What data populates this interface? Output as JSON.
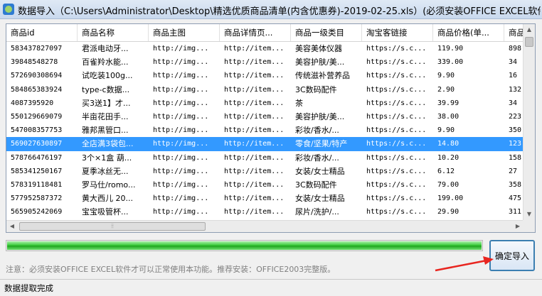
{
  "window": {
    "title": "数据导入（C:\\Users\\Administrator\\Desktop\\精选优质商品清单(内含优惠券)-2019-02-25.xls）(必须安装OFFICE EXCEL软件"
  },
  "table": {
    "columns": [
      "商品id",
      "商品名称",
      "商品主图",
      "商品详情页...",
      "商品一级类目",
      "淘宝客链接",
      "商品价格(单...",
      "商品"
    ],
    "rows": [
      [
        "583437827097",
        "君派电动牙...",
        "http://img...",
        "http://item...",
        "美容美体仪器",
        "https://s.c...",
        "119.90",
        "898"
      ],
      [
        "39848548278",
        "百雀羚水能...",
        "http://img...",
        "http://item...",
        "美容护肤/美...",
        "https://s.c...",
        "339.00",
        "34"
      ],
      [
        "572690308694",
        "试吃装100g...",
        "http://img...",
        "http://item...",
        "传统滋补营养品",
        "https://s.c...",
        "9.90",
        "16"
      ],
      [
        "584865383924",
        "type-c数据...",
        "http://img...",
        "http://item...",
        "3C数码配件",
        "https://s.c...",
        "2.90",
        "132"
      ],
      [
        "4087395920",
        "买3送1】才...",
        "http://img...",
        "http://item...",
        "茶",
        "https://s.c...",
        "39.99",
        "34"
      ],
      [
        "550129669079",
        "半亩花田手...",
        "http://img...",
        "http://item...",
        "美容护肤/美...",
        "https://s.c...",
        "38.00",
        "223"
      ],
      [
        "547008357753",
        "雅邦黑管口...",
        "http://img...",
        "http://item...",
        "彩妆/香水/...",
        "https://s.c...",
        "9.90",
        "350"
      ],
      [
        "569027630897",
        "全店满3袋包...",
        "http://img...",
        "http://item...",
        "零食/坚果/特产",
        "https://s.c...",
        "14.80",
        "123"
      ],
      [
        "578766476197",
        "3个×1盒 葫...",
        "http://img...",
        "http://item...",
        "彩妆/香水/...",
        "https://s.c...",
        "10.20",
        "158"
      ],
      [
        "585341250167",
        "夏季冰丝无...",
        "http://img...",
        "http://item...",
        "女装/女士精品",
        "https://s.c...",
        "6.12",
        "27"
      ],
      [
        "578319118481",
        "罗马仕/romo...",
        "http://img...",
        "http://item...",
        "3C数码配件",
        "https://s.c...",
        "79.00",
        "358"
      ],
      [
        "577952587372",
        "黄大西儿 20...",
        "http://img...",
        "http://item...",
        "女装/女士精品",
        "https://s.c...",
        "199.00",
        "475"
      ],
      [
        "565905242069",
        "宝宝吸管杯...",
        "http://img...",
        "http://item...",
        "尿片/洗护/...",
        "https://s.c...",
        "29.90",
        "311"
      ]
    ],
    "selected_row_index": 7
  },
  "progress": {
    "percent": 100
  },
  "confirm_button": {
    "label": "确定导入"
  },
  "notice": "注意：必须安装OFFICE EXCEL软件才可以正常使用本功能。推荐安装：OFFICE2003完整版。",
  "status_bar": {
    "text": "数据提取完成"
  },
  "colors": {
    "selected_row": "#3399ff",
    "progress_fill": "#2fc22f",
    "annotation_arrow": "#e8251f"
  }
}
